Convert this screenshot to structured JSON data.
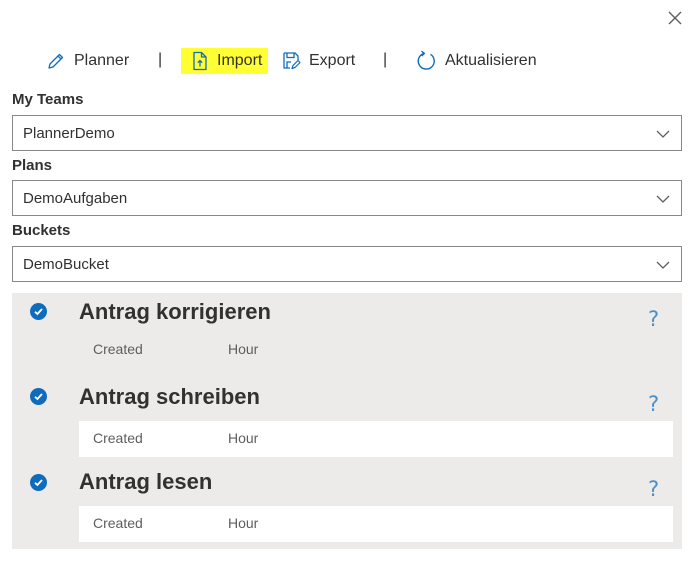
{
  "toolbar": {
    "planner_label": "Planner",
    "separator_1": "|",
    "import_label": "Import",
    "export_label": "Export",
    "separator_2": "|",
    "refresh_label": "Aktualisieren"
  },
  "fields": {
    "teams": {
      "label": "My Teams",
      "value": "PlannerDemo"
    },
    "plans": {
      "label": "Plans",
      "value": "DemoAufgaben"
    },
    "buckets": {
      "label": "Buckets",
      "value": "DemoBucket"
    }
  },
  "tasks": [
    {
      "title": "Antrag korrigieren",
      "created": "Created",
      "hour": "Hour",
      "help": "?"
    },
    {
      "title": "Antrag schreiben",
      "created": "Created",
      "hour": "Hour",
      "help": "?"
    },
    {
      "title": "Antrag lesen",
      "created": "Created",
      "hour": "Hour",
      "help": "?"
    }
  ],
  "icons": {
    "close": "close-icon",
    "planner": "pencil-icon",
    "import": "file-upload-icon",
    "export": "save-as-icon",
    "refresh": "refresh-icon",
    "chevron": "chevron-down-icon",
    "check": "checkmark-circle-icon"
  },
  "colors": {
    "accent": "#0f6cbd",
    "highlight": "#ffff33",
    "task_panel_bg": "#edebe9",
    "help": "#4a90c8"
  }
}
